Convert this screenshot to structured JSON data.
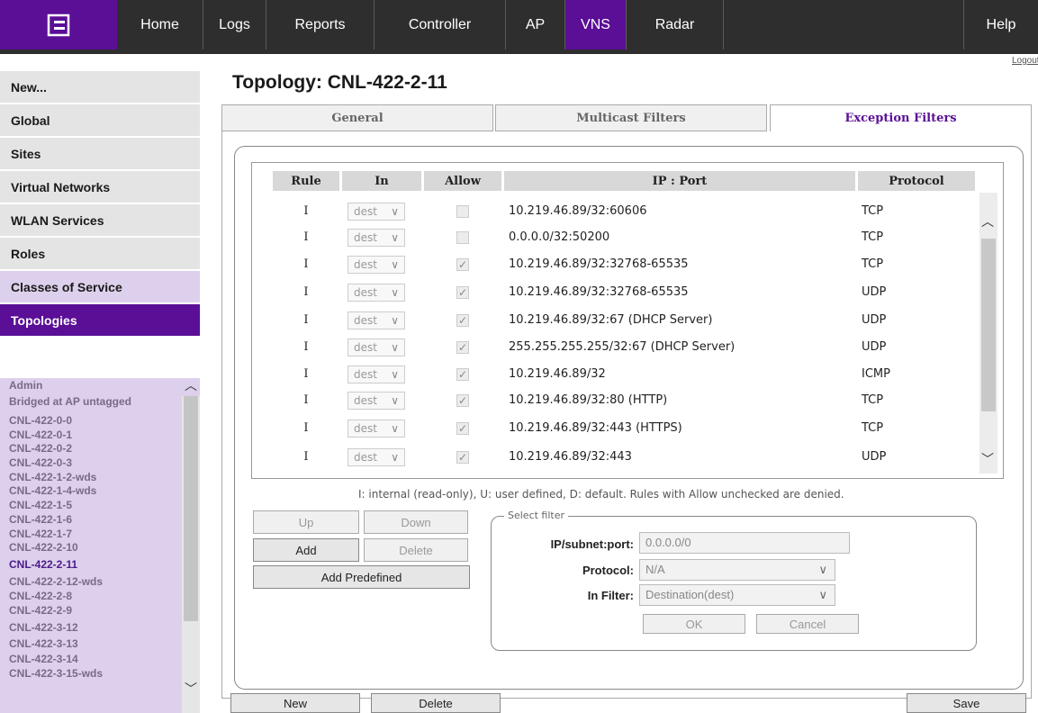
{
  "nav": {
    "items": [
      {
        "label": "Home"
      },
      {
        "label": "Logs"
      },
      {
        "label": "Reports"
      },
      {
        "label": "Controller"
      },
      {
        "label": "AP"
      },
      {
        "label": "VNS"
      },
      {
        "label": "Radar"
      },
      {
        "label": "Help"
      }
    ],
    "active": "VNS",
    "logout": "Logout"
  },
  "sidebar": {
    "items": [
      {
        "label": "New..."
      },
      {
        "label": "Global"
      },
      {
        "label": "Sites"
      },
      {
        "label": "Virtual Networks"
      },
      {
        "label": "WLAN Services"
      },
      {
        "label": "Roles"
      },
      {
        "label": "Classes of Service"
      },
      {
        "label": "Topologies"
      }
    ],
    "topologies": [
      "Admin",
      "Bridged at AP untagged",
      "CNL-422-0-0",
      "CNL-422-0-1",
      "CNL-422-0-2",
      "CNL-422-0-3",
      "CNL-422-1-2-wds",
      "CNL-422-1-4-wds",
      "CNL-422-1-5",
      "CNL-422-1-6",
      "CNL-422-1-7",
      "CNL-422-2-10",
      "CNL-422-2-11",
      "CNL-422-2-12-wds",
      "CNL-422-2-8",
      "CNL-422-2-9",
      "CNL-422-3-12",
      "CNL-422-3-13",
      "CNL-422-3-14",
      "CNL-422-3-15-wds"
    ],
    "selected_topology": "CNL-422-2-11"
  },
  "page": {
    "title": "Topology: CNL-422-2-11",
    "tabs": [
      {
        "label": "General"
      },
      {
        "label": "Multicast Filters"
      },
      {
        "label": "Exception Filters"
      }
    ],
    "active_tab": "Exception Filters"
  },
  "table": {
    "headers": {
      "rule": "Rule",
      "in": "In",
      "allow": "Allow",
      "ipport": "IP : Port",
      "protocol": "Protocol"
    },
    "rows": [
      {
        "rule": "I",
        "in": "dest",
        "allow": false,
        "ipport": "10.219.46.89/32:60606",
        "protocol": "TCP"
      },
      {
        "rule": "I",
        "in": "dest",
        "allow": false,
        "ipport": "0.0.0.0/32:50200",
        "protocol": "TCP"
      },
      {
        "rule": "I",
        "in": "dest",
        "allow": true,
        "ipport": "10.219.46.89/32:32768-65535",
        "protocol": "TCP"
      },
      {
        "rule": "I",
        "in": "dest",
        "allow": true,
        "ipport": "10.219.46.89/32:32768-65535",
        "protocol": "UDP"
      },
      {
        "rule": "I",
        "in": "dest",
        "allow": true,
        "ipport": "10.219.46.89/32:67 (DHCP Server)",
        "protocol": "UDP"
      },
      {
        "rule": "I",
        "in": "dest",
        "allow": true,
        "ipport": "255.255.255.255/32:67 (DHCP Server)",
        "protocol": "UDP"
      },
      {
        "rule": "I",
        "in": "dest",
        "allow": true,
        "ipport": "10.219.46.89/32",
        "protocol": "ICMP"
      },
      {
        "rule": "I",
        "in": "dest",
        "allow": true,
        "ipport": "10.219.46.89/32:80 (HTTP)",
        "protocol": "TCP"
      },
      {
        "rule": "I",
        "in": "dest",
        "allow": true,
        "ipport": "10.219.46.89/32:443 (HTTPS)",
        "protocol": "TCP"
      },
      {
        "rule": "I",
        "in": "dest",
        "allow": true,
        "ipport": "10.219.46.89/32:443",
        "protocol": "UDP"
      }
    ],
    "legend": "I: internal (read-only), U: user defined, D: default. Rules with Allow unchecked are denied."
  },
  "buttons": {
    "up": "Up",
    "down": "Down",
    "add": "Add",
    "delete": "Delete",
    "add_predefined": "Add Predefined",
    "new": "New",
    "delete_bottom": "Delete",
    "save": "Save"
  },
  "filter": {
    "legend": "Select filter",
    "ip_label": "IP/subnet:port:",
    "ip_value": "0.0.0.0/0",
    "protocol_label": "Protocol:",
    "protocol_value": "N/A",
    "infilter_label": "In Filter:",
    "infilter_value": "Destination(dest)",
    "ok": "OK",
    "cancel": "Cancel"
  },
  "colors": {
    "brand": "#5a0f96",
    "nav_bg": "#2e2e2e",
    "sidebar_light": "#ddd0ec"
  }
}
